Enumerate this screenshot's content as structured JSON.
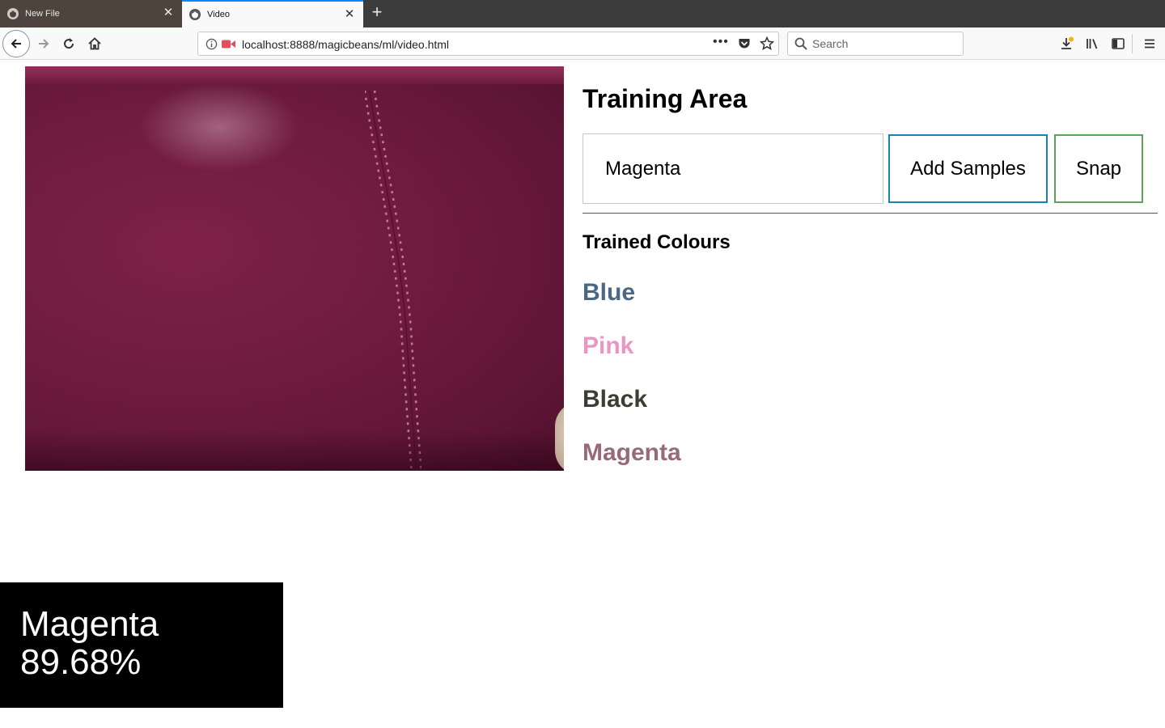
{
  "tabs": [
    {
      "title": "New File",
      "icon": "github-icon",
      "active": false
    },
    {
      "title": "Video",
      "icon": "github-icon",
      "active": true
    }
  ],
  "toolbar": {
    "url": "localhost:8888/magicbeans/ml/video.html",
    "search_placeholder": "Search"
  },
  "training": {
    "heading": "Training Area",
    "label_value": "Magenta",
    "add_samples_label": "Add Samples",
    "snap_label": "Snap"
  },
  "trained": {
    "heading": "Trained Colours",
    "colours": [
      {
        "name": "Blue",
        "color": "#4a6783"
      },
      {
        "name": "Pink",
        "color": "#e797c6"
      },
      {
        "name": "Black",
        "color": "#3d3d35"
      },
      {
        "name": "Magenta",
        "color": "#976a77"
      }
    ]
  },
  "prediction": {
    "label": "Magenta",
    "confidence": "89.68%"
  },
  "colors": {
    "tab_accent": "#0a84ff",
    "add_samples_border": "#1486a8",
    "snap_border": "#5aa55a"
  }
}
